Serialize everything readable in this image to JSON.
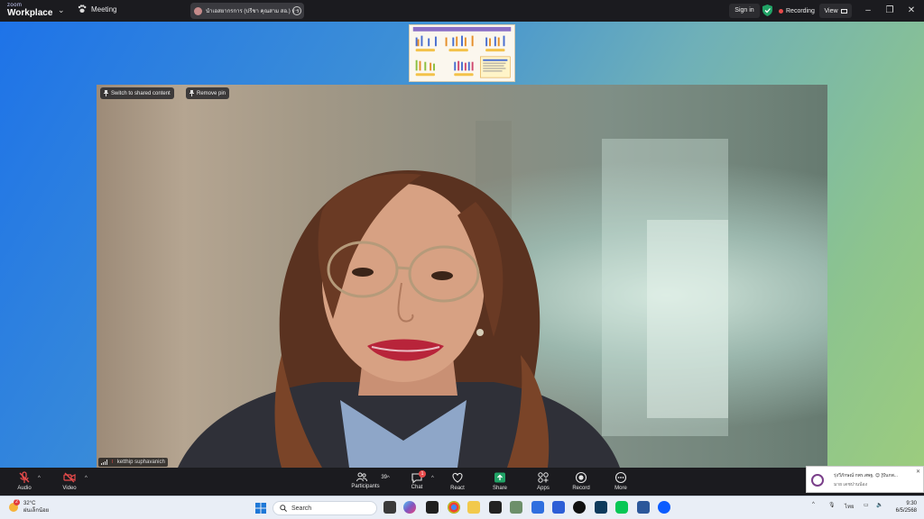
{
  "titlebar": {
    "brand_top": "zoom",
    "brand_bottom": "Workplace",
    "meeting_label": "Meeting",
    "share_title": "นำเอสยากรการ (ปรีชา คุณสาม สอ.) ร ร",
    "sign_in": "Sign in",
    "recording": "Recording",
    "view": "View"
  },
  "stage": {
    "switch_shared": "Switch to shared content",
    "remove_pin": "Remove pin",
    "participant_name": "ketthip suphavanich"
  },
  "toolbar": {
    "audio": "Audio",
    "video": "Video",
    "participants": "Participants",
    "participants_count": "39",
    "chat": "Chat",
    "chat_badge": "1",
    "react": "React",
    "share": "Share",
    "apps": "Apps",
    "record": "Record",
    "more": "More"
  },
  "notification": {
    "line1": "รุ่งวีภักษณ์ กพร.สพฐ. 😊 [ปันกพ...",
    "line2": "มาย เดชปานน้อง"
  },
  "taskbar": {
    "weather_badge": "2",
    "temperature": "32°C",
    "weather_desc": "ฝนเล็กน้อย",
    "search_placeholder": "Search",
    "lang": "ไทย",
    "time": "9:30",
    "date": "6/5/2568"
  },
  "colors": {
    "accent_green": "#21a366",
    "rec_red": "#e84b4b",
    "toolbar_bg": "#1b1b1f"
  }
}
